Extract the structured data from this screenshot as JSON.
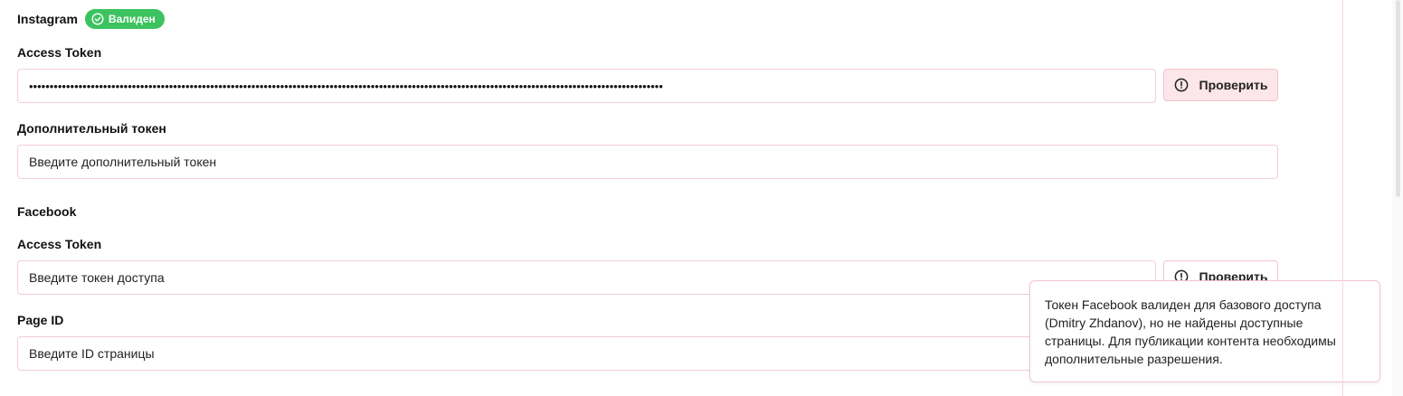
{
  "instagram": {
    "title": "Instagram",
    "badge": "Валиден",
    "access_token_label": "Access Token",
    "access_token_value": "••••••••••••••••••••••••••••••••••••••••••••••••••••••••••••••••••••••••••••••••••••••••••••••••••••••••••••••••••••••••••••••••••••••••••••••••••••••••••",
    "check_button": "Проверить",
    "extra_token_label": "Дополнительный токен",
    "extra_token_placeholder": "Введите дополнительный токен"
  },
  "facebook": {
    "title": "Facebook",
    "access_token_label": "Access Token",
    "access_token_placeholder": "Введите токен доступа",
    "check_button": "Проверить",
    "page_id_label": "Page ID",
    "page_id_placeholder": "Введите ID страницы"
  },
  "tooltip": {
    "text": "Токен Facebook валиден для базового доступа (Dmitry Zhdanov), но не найдены доступные страницы. Для публикации контента необходимы дополнительные разрешения."
  },
  "colors": {
    "badge_green": "#3cc35f",
    "border_pink": "#f3cdd5",
    "button_pink_bg": "#fde6ea"
  },
  "icons": {
    "badge": "check-circle-icon",
    "check_button": "alert-circle-icon"
  }
}
